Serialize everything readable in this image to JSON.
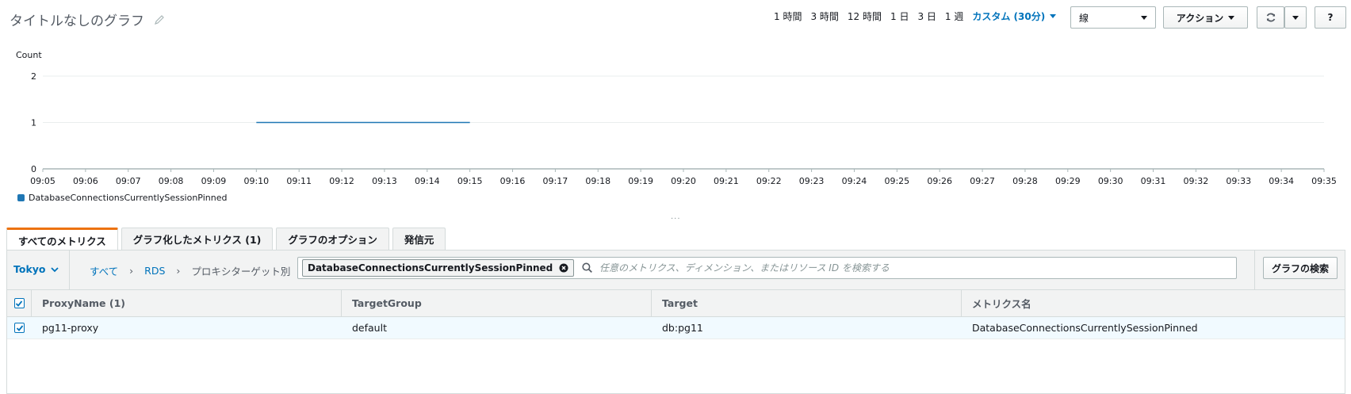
{
  "header": {
    "title": "タイトルなしのグラフ",
    "time_ranges": [
      "1 時間",
      "3 時間",
      "12 時間",
      "1 日",
      "3 日",
      "1 週"
    ],
    "custom_range": "カスタム (30分)",
    "chart_type_select": "線",
    "actions_label": "アクション",
    "help_label": "?"
  },
  "chart_data": {
    "type": "line",
    "ylabel": "Count",
    "ylim": [
      0,
      2
    ],
    "yticks": [
      "0",
      "1",
      "2"
    ],
    "x": [
      "09:05",
      "09:06",
      "09:07",
      "09:08",
      "09:09",
      "09:10",
      "09:11",
      "09:12",
      "09:13",
      "09:14",
      "09:15",
      "09:16",
      "09:17",
      "09:18",
      "09:19",
      "09:20",
      "09:21",
      "09:22",
      "09:23",
      "09:24",
      "09:25",
      "09:26",
      "09:27",
      "09:28",
      "09:29",
      "09:30",
      "09:31",
      "09:32",
      "09:33",
      "09:34",
      "09:35"
    ],
    "series": [
      {
        "name": "DatabaseConnectionsCurrentlySessionPinned",
        "color": "#1f77b4",
        "points": [
          [
            "09:10",
            1
          ],
          [
            "09:15",
            1
          ]
        ]
      }
    ],
    "grid": true,
    "legend": "bottom-left"
  },
  "resize_handle": "...",
  "tabs": [
    {
      "label": "すべてのメトリクス",
      "active": true
    },
    {
      "label": "グラフ化したメトリクス (1)",
      "active": false
    },
    {
      "label": "グラフのオプション",
      "active": false
    },
    {
      "label": "発信元",
      "active": false
    }
  ],
  "browser": {
    "region": "Tokyo",
    "breadcrumb": [
      "すべて",
      "RDS",
      "プロキシターゲット別"
    ],
    "filter_chip": "DatabaseConnectionsCurrentlySessionPinned",
    "search_placeholder": "任意のメトリクス、ディメンション、またはリソース ID を検索する",
    "graph_search_label": "グラフの検索"
  },
  "table": {
    "columns": [
      "ProxyName (1)",
      "TargetGroup",
      "Target",
      "メトリクス名"
    ],
    "rows": [
      {
        "checked": true,
        "cells": [
          "pg11-proxy",
          "default",
          "db:pg11",
          "DatabaseConnectionsCurrentlySessionPinned"
        ]
      }
    ]
  },
  "colors": {
    "accent_link": "#0073bb",
    "active_tab": "#ec7211",
    "series": "#1f77b4"
  }
}
